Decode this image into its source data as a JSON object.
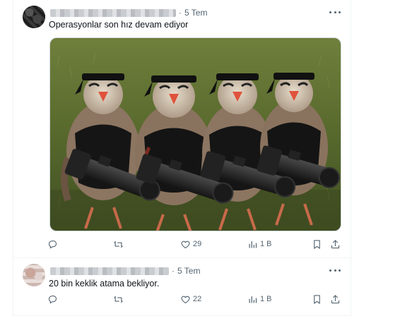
{
  "posts": [
    {
      "time": "5 Tem",
      "separator": "·",
      "text": "Operasyonlar son hız devam ediyor",
      "media": {
        "description_icon": "partridges-with-miniguns-image"
      },
      "actions": {
        "reply": "",
        "retweet": "",
        "like": "29",
        "views": "1 B"
      }
    },
    {
      "time": "5 Tem",
      "separator": "·",
      "text": "20 bin keklik atama bekliyor.",
      "actions": {
        "reply": "",
        "retweet": "",
        "like": "22",
        "views": "1 B"
      }
    }
  ],
  "colors": {
    "text": "#0f1419",
    "secondary": "#536471",
    "border": "#eff3f4"
  }
}
